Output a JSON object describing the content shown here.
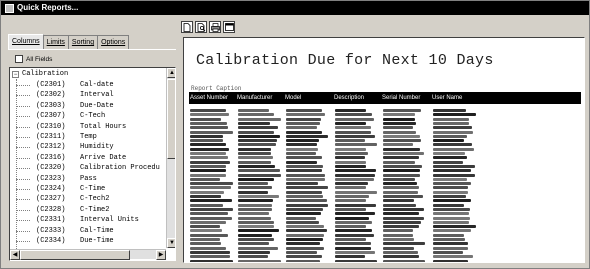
{
  "window": {
    "title": "Quick Reports..."
  },
  "tabs": [
    {
      "label": "Columns",
      "active": true
    },
    {
      "label": "Limits",
      "active": false
    },
    {
      "label": "Sorting",
      "active": false
    },
    {
      "label": "Options",
      "active": false
    }
  ],
  "all_fields": {
    "label": "All Fields",
    "checked": false
  },
  "tree": {
    "root": {
      "label": "Calibration",
      "expanded": true
    },
    "items": [
      {
        "code": "(C2301)",
        "name": "Cal-date"
      },
      {
        "code": "(C2302)",
        "name": "Interval"
      },
      {
        "code": "(C2303)",
        "name": "Due-Date"
      },
      {
        "code": "(C2307)",
        "name": "C-Tech"
      },
      {
        "code": "(C2310)",
        "name": "Total Hours"
      },
      {
        "code": "(C2311)",
        "name": "Temp"
      },
      {
        "code": "(C2312)",
        "name": "Humidity"
      },
      {
        "code": "(C2316)",
        "name": "Arrive Date"
      },
      {
        "code": "(C2320)",
        "name": "Calibration Procedu"
      },
      {
        "code": "(C2323)",
        "name": "Pass"
      },
      {
        "code": "(C2324)",
        "name": "C-Time"
      },
      {
        "code": "(C2327)",
        "name": "C-Tech2"
      },
      {
        "code": "(C2328)",
        "name": "C-Time2"
      },
      {
        "code": "(C2331)",
        "name": "Interval Units"
      },
      {
        "code": "(C2333)",
        "name": "Cal-Time"
      },
      {
        "code": "(C2334)",
        "name": "Due-Time"
      }
    ]
  },
  "toolbar": {
    "buttons": [
      {
        "icon": "new-page-icon"
      },
      {
        "icon": "print-preview-icon"
      },
      {
        "icon": "print-icon"
      },
      {
        "icon": "window-icon"
      }
    ]
  },
  "report": {
    "title": "Calibration Due for Next 10 Days",
    "caption": "Report Caption",
    "columns": [
      "Asset Number",
      "Manufacturer",
      "Model",
      "Description",
      "Serial Number",
      "User Name"
    ]
  }
}
